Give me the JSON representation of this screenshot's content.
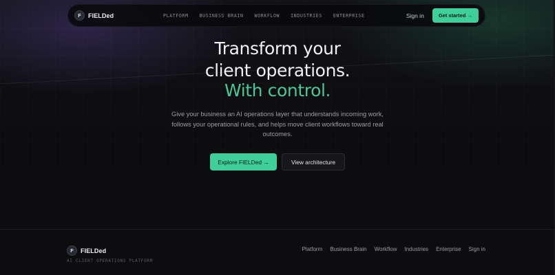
{
  "nav": {
    "brand_initial": "F",
    "brand_name": "FIELDed",
    "links": [
      "PLATFORM",
      "BUSINESS BRAIN",
      "WORKFLOW",
      "INDUSTRIES",
      "ENTERPRISE"
    ],
    "sign_in": "Sign in",
    "cta": "Get started →"
  },
  "hero": {
    "title_line1": "Transform your",
    "title_line2": "client operations.",
    "title_line3": "With control.",
    "subtitle": "Give your business an AI operations layer that understands incoming work, follows your operational rules, and helps move client workflows toward real outcomes.",
    "primary_cta": "Explore FIELDed →",
    "secondary_cta": "View architecture"
  },
  "footer": {
    "brand_initial": "F",
    "brand_name": "FIELDed",
    "tagline": "AI CLIENT OPERATIONS PLATFORM",
    "links": [
      "Platform",
      "Business Brain",
      "Workflow",
      "Industries",
      "Enterprise",
      "Sign in"
    ]
  },
  "colors": {
    "accent": "#3fcf9a",
    "accent_text": "#48c995",
    "background": "#0d0d10"
  }
}
